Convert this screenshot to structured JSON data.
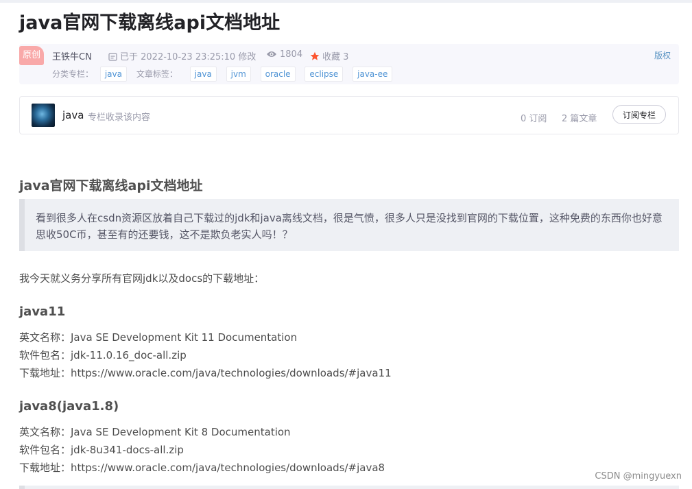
{
  "article": {
    "title": "java官网下载离线api文档地址",
    "original_badge": "原创",
    "author": "王铁牛CN",
    "date_text": "已于 2022-10-23 23:25:10 修改",
    "views": "1804",
    "favorites_text": "收藏 3",
    "copyright_label": "版权",
    "category_label": "分类专栏：",
    "category_tags": [
      "java"
    ],
    "article_tags_label": "文章标签：",
    "article_tags": [
      "java",
      "jvm",
      "oracle",
      "eclipse",
      "java-ee"
    ]
  },
  "column": {
    "name": "java",
    "description": "专栏收录该内容",
    "subscribers": "0 订阅",
    "articles": "2 篇文章",
    "subscribe_button": "订阅专栏"
  },
  "content": {
    "heading": "java官网下载离线api文档地址",
    "quote": "看到很多人在csdn资源区放着自己下载过的jdk和java离线文档，很是气愤，很多人只是没找到官网的下载位置，这种免费的东西你也好意思收50C币，甚至有的还要钱，这不是欺负老实人吗！？",
    "intro": "我今天就义务分享所有官网jdk以及docs的下载地址：",
    "sections": [
      {
        "title": "java11",
        "lines": [
          "英文名称：Java SE Development Kit 11 Documentation",
          "软件包名：jdk-11.0.16_doc-all.zip",
          "下载地址：https://www.oracle.com/java/technologies/downloads/#java11"
        ]
      },
      {
        "title": "java8(java1.8)",
        "lines": [
          "英文名称：Java SE Development Kit 8 Documentation",
          "软件包名：jdk-8u341-docs-all.zip",
          "下载地址：https://www.oracle.com/java/technologies/downloads/#java8"
        ]
      }
    ]
  },
  "watermark": "CSDN @mingyuexn",
  "icons": {
    "date": "calendar-edit-icon",
    "views": "eye-icon",
    "favorites": "star-icon"
  },
  "colors": {
    "badge": "#f9a9a9",
    "tag_text": "#5094d5",
    "favorite_icon": "#fc5531"
  }
}
